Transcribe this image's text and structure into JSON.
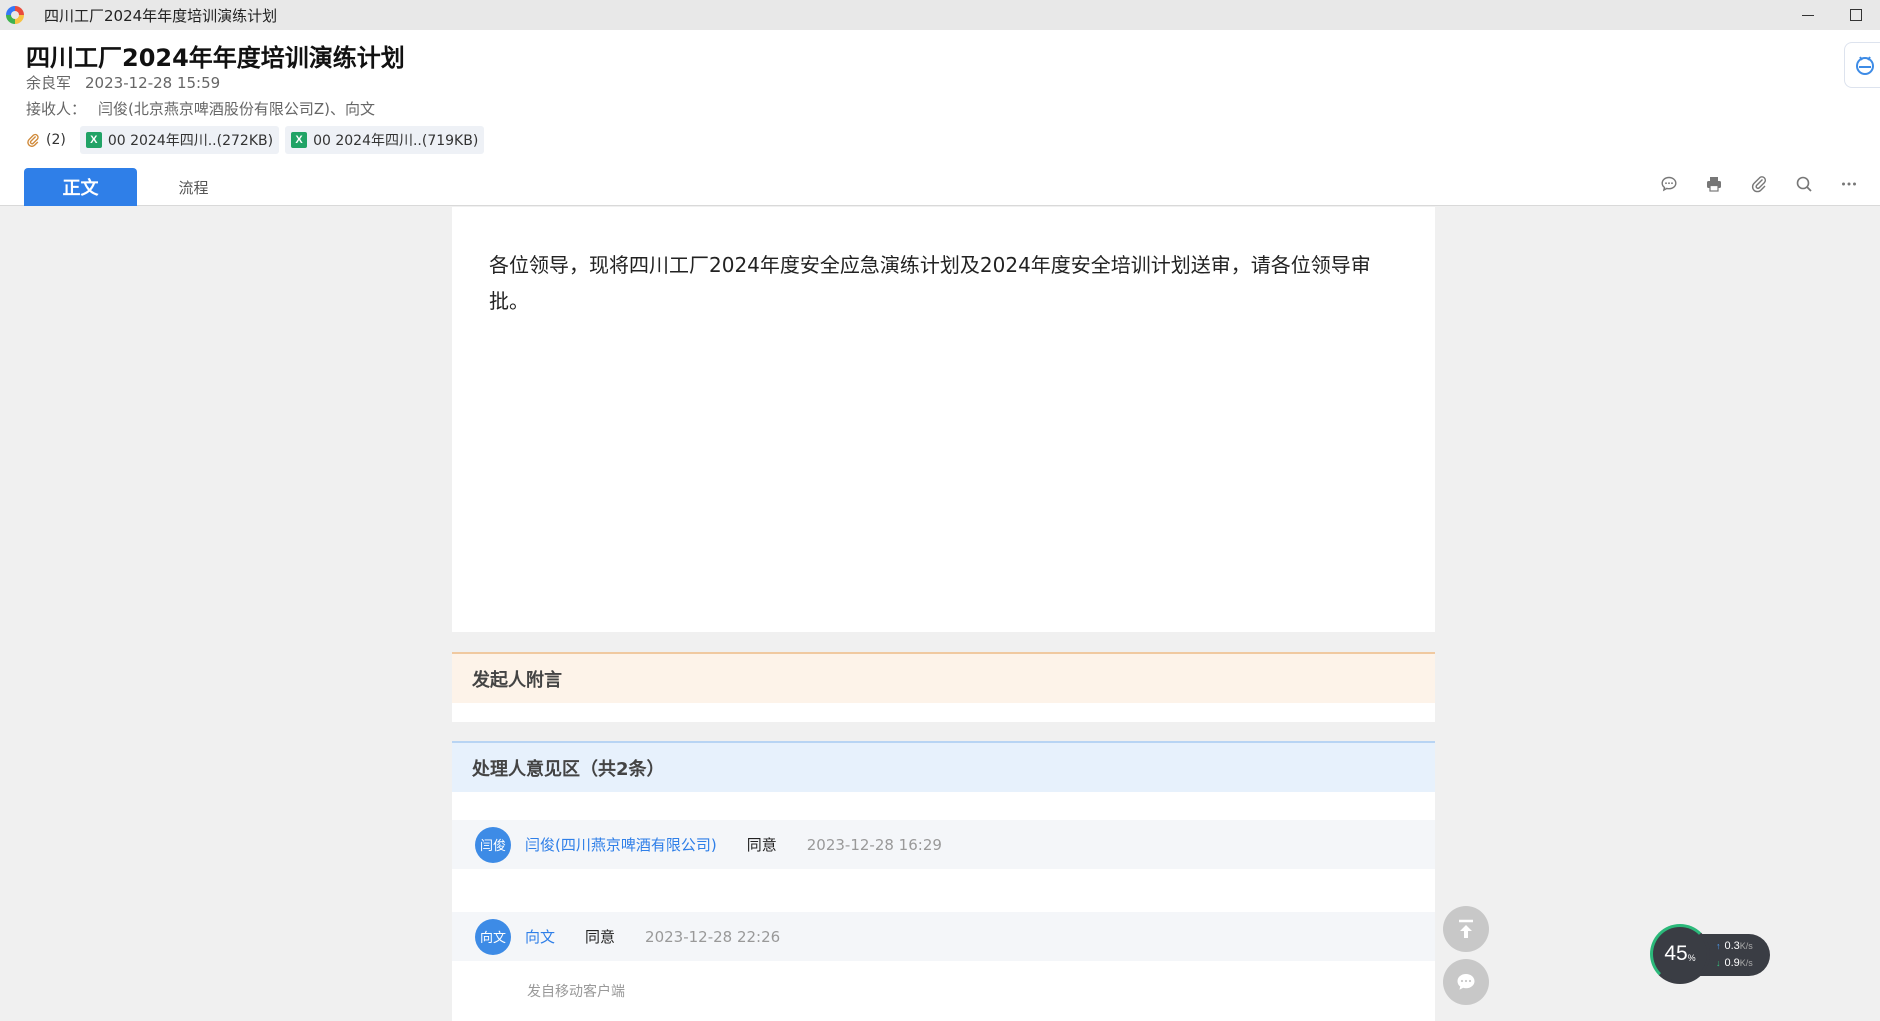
{
  "window": {
    "title": "四川工厂2024年年度培训演练计划"
  },
  "header": {
    "doc_title": "四川工厂2024年年度培训演练计划",
    "sender": "余良军",
    "sent_time": "2023-12-28 15:59",
    "recipients_label": "接收人：",
    "recipients": "闫俊(北京燕京啤酒股份有限公司Z)、向文",
    "attachment_count": "(2)",
    "attachments": [
      {
        "icon": "excel-icon",
        "label": "00 2024年四川..(272KB)"
      },
      {
        "icon": "excel-icon",
        "label": "00 2024年四川..(719KB)"
      }
    ]
  },
  "tabs": [
    {
      "label": "正文",
      "active": true
    },
    {
      "label": "流程",
      "active": false
    }
  ],
  "toolbar": [
    "comment-icon",
    "print-icon",
    "attachment-icon",
    "search-icon",
    "more-icon"
  ],
  "body": {
    "text": "各位领导，现将四川工厂2024年度安全应急演练计划及2024年度安全培训计划送审，请各位领导审批。"
  },
  "note_section": {
    "title": "发起人附言"
  },
  "opinions": {
    "title": "处理人意见区（共2条）",
    "items": [
      {
        "avatar": "闫俊",
        "name": "闫俊(四川燕京啤酒有限公司)",
        "verdict": "同意",
        "time": "2023-12-28 16:29"
      },
      {
        "avatar": "向文",
        "name": "向文",
        "verdict": "同意",
        "time": "2023-12-28 22:26",
        "source": "发自移动客户端"
      }
    ]
  },
  "net_widget": {
    "percent": "45",
    "percent_unit": "%",
    "up": "0.3",
    "down": "0.9",
    "unit": "K/s"
  },
  "colors": {
    "accent": "#2f7fe8",
    "note_bg": "#fdf3e9",
    "opinion_bg": "#e7f1fc",
    "excel": "#21a366"
  }
}
